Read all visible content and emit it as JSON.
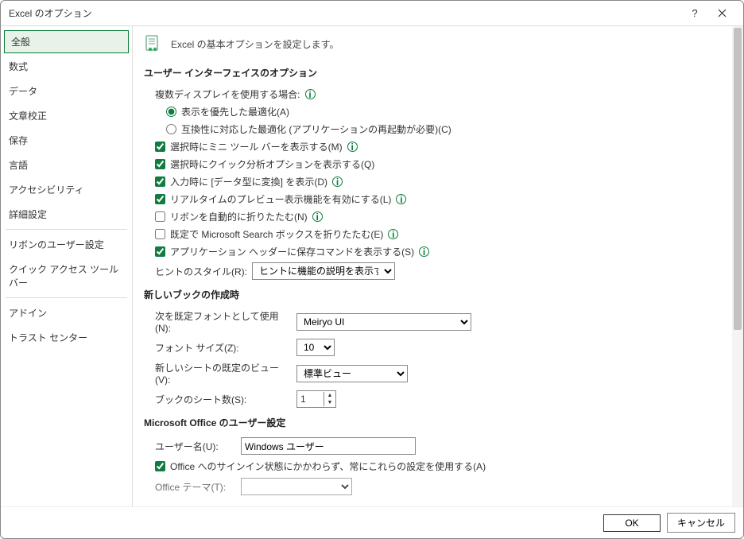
{
  "title": "Excel のオプション",
  "sidebar": [
    "全般",
    "数式",
    "データ",
    "文章校正",
    "保存",
    "言語",
    "アクセシビリティ",
    "詳細設定",
    "リボンのユーザー設定",
    "クイック アクセス ツール バー",
    "アドイン",
    "トラスト センター"
  ],
  "main_heading": "Excel の基本オプションを設定します。",
  "sec_ui": "ユーザー インターフェイスのオプション",
  "disp_label": "複数ディスプレイを使用する場合:",
  "radio1": "表示を優先した最適化(A)",
  "radio2": "互換性に対応した最適化 (アプリケーションの再起動が必要)(C)",
  "cb1": "選択時にミニ ツール バーを表示する(M)",
  "cb2": "選択時にクイック分析オプションを表示する(Q)",
  "cb3": "入力時に [データ型に変換] を表示(D)",
  "cb4": "リアルタイムのプレビュー表示機能を有効にする(L)",
  "cb5": "リボンを自動的に折りたたむ(N)",
  "cb6": "既定で Microsoft Search ボックスを折りたたむ(E)",
  "cb7": "アプリケーション ヘッダーに保存コマンドを表示する(S)",
  "hint_label": "ヒントのスタイル(R):",
  "hint_value": "ヒントに機能の説明を表示する",
  "sec_newbook": "新しいブックの作成時",
  "font_label": "次を既定フォントとして使用(N):",
  "font_value": "Meiryo UI",
  "fontsize_label": "フォント サイズ(Z):",
  "fontsize_value": "10",
  "view_label": "新しいシートの既定のビュー(V):",
  "view_value": "標準ビュー",
  "sheets_label": "ブックのシート数(S):",
  "sheets_value": "1",
  "sec_office": "Microsoft Office のユーザー設定",
  "username_label": "ユーザー名(U):",
  "username_value": "Windows ユーザー",
  "cb_signin": "Office へのサインイン状態にかかわらず、常にこれらの設定を使用する(A)",
  "theme_label_partial": "Office テーマ(T):",
  "ok": "OK",
  "cancel": "キャンセル"
}
